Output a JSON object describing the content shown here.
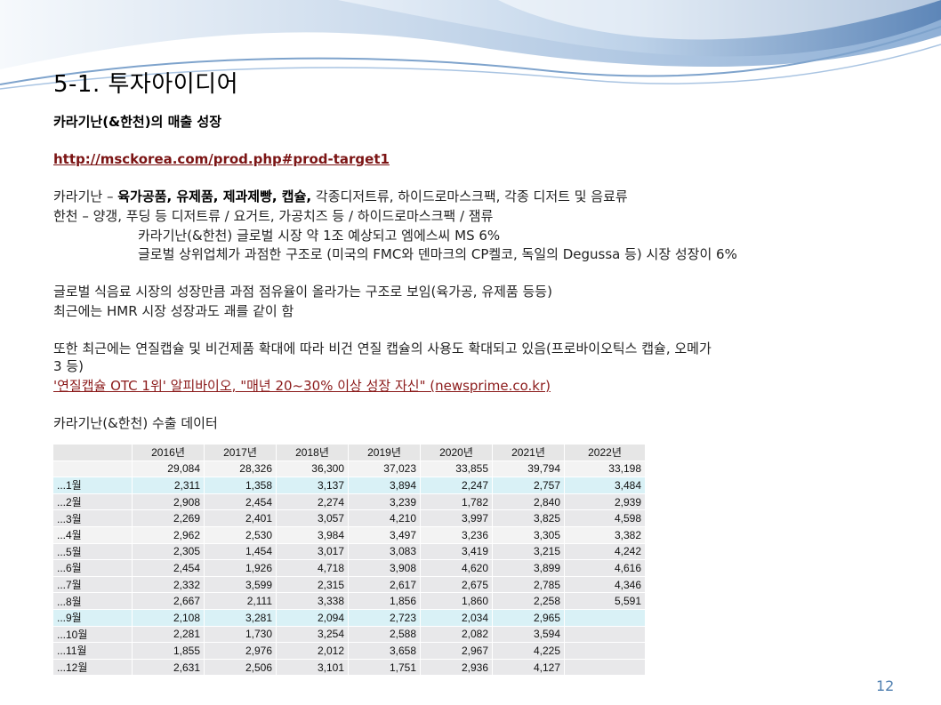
{
  "slide": {
    "title": "5-1. 투자아이디어",
    "subtitle": "카라기난(&한천)의 매출 성장",
    "link1": "http://msckorea.com/prod.php#prod-target1",
    "line1_prefix": "카라기난 – ",
    "line1_bold": "육가공품, 유제품, 제과제빵, 캡슐,",
    "line1_suffix": " 각종디저트류, 하이드로마스크팩, 각종 디저트 및 음료류",
    "line2": "한천 – 양갱, 푸딩 등 디저트류 / 요거트, 가공치즈 등 / 하이드로마스크팩 / 잼류",
    "line3": "카라기난(&한천) 글로벌 시장 약 1조 예상되고 엠에스씨 MS 6%",
    "line4": "글로벌 상위업체가 과점한 구조로 (미국의 FMC와 덴마크의 CP켈코, 독일의 Degussa 등) 시장 성장이 6%",
    "line5": "글로벌 식음료 시장의 성장만큼 과점 점유율이 올라가는 구조로 보임(육가공, 유제품 등등)",
    "line6": "최근에는 HMR 시장 성장과도 괘를 같이 함",
    "line7": "또한 최근에는 연질캡슐 및 비건제품 확대에 따라 비건 연질 캡슐의 사용도 확대되고 있음(프로바이오틱스 캡슐, 오메가",
    "line8": "3 등)",
    "link2": "'연질캡슐 OTC 1위' 알피바이오, \"매년 20~30% 이상 성장 자신\" (newsprime.co.kr)",
    "table_heading": "카라기난(&한천) 수출 데이터",
    "page_number": "12"
  },
  "table": {
    "headers": [
      "",
      "2016년",
      "2017년",
      "2018년",
      "2019년",
      "2020년",
      "2021년",
      "2022년"
    ],
    "rows": [
      {
        "label": "",
        "values": [
          "29,084",
          "28,326",
          "36,300",
          "37,023",
          "33,855",
          "39,794",
          "33,198"
        ]
      },
      {
        "label": "...1월",
        "values": [
          "2,311",
          "1,358",
          "3,137",
          "3,894",
          "2,247",
          "2,757",
          "3,484"
        ]
      },
      {
        "label": "...2월",
        "values": [
          "2,908",
          "2,454",
          "2,274",
          "3,239",
          "1,782",
          "2,840",
          "2,939"
        ]
      },
      {
        "label": "...3월",
        "values": [
          "2,269",
          "2,401",
          "3,057",
          "4,210",
          "3,997",
          "3,825",
          "4,598"
        ]
      },
      {
        "label": "...4월",
        "values": [
          "2,962",
          "2,530",
          "3,984",
          "3,497",
          "3,236",
          "3,305",
          "3,382"
        ]
      },
      {
        "label": "...5월",
        "values": [
          "2,305",
          "1,454",
          "3,017",
          "3,083",
          "3,419",
          "3,215",
          "4,242"
        ]
      },
      {
        "label": "...6월",
        "values": [
          "2,454",
          "1,926",
          "4,718",
          "3,908",
          "4,620",
          "3,899",
          "4,616"
        ]
      },
      {
        "label": "...7월",
        "values": [
          "2,332",
          "3,599",
          "2,315",
          "2,617",
          "2,675",
          "2,785",
          "4,346"
        ]
      },
      {
        "label": "...8월",
        "values": [
          "2,667",
          "2,111",
          "3,338",
          "1,856",
          "1,860",
          "2,258",
          "5,591"
        ]
      },
      {
        "label": "...9월",
        "values": [
          "2,108",
          "3,281",
          "2,094",
          "2,723",
          "2,034",
          "2,965",
          ""
        ]
      },
      {
        "label": "...10월",
        "values": [
          "2,281",
          "1,730",
          "3,254",
          "2,588",
          "2,082",
          "3,594",
          ""
        ]
      },
      {
        "label": "...11월",
        "values": [
          "1,855",
          "2,976",
          "2,012",
          "3,658",
          "2,967",
          "4,225",
          ""
        ]
      },
      {
        "label": "...12월",
        "values": [
          "2,631",
          "2,506",
          "3,101",
          "1,751",
          "2,936",
          "4,127",
          ""
        ]
      }
    ]
  },
  "colors": {
    "link": "#7b1414",
    "table_header": "#e6e6e6",
    "row_cyan": "#d9f1f6",
    "row_gray": "#e8e8ea",
    "page_number": "#4f7fb0"
  }
}
